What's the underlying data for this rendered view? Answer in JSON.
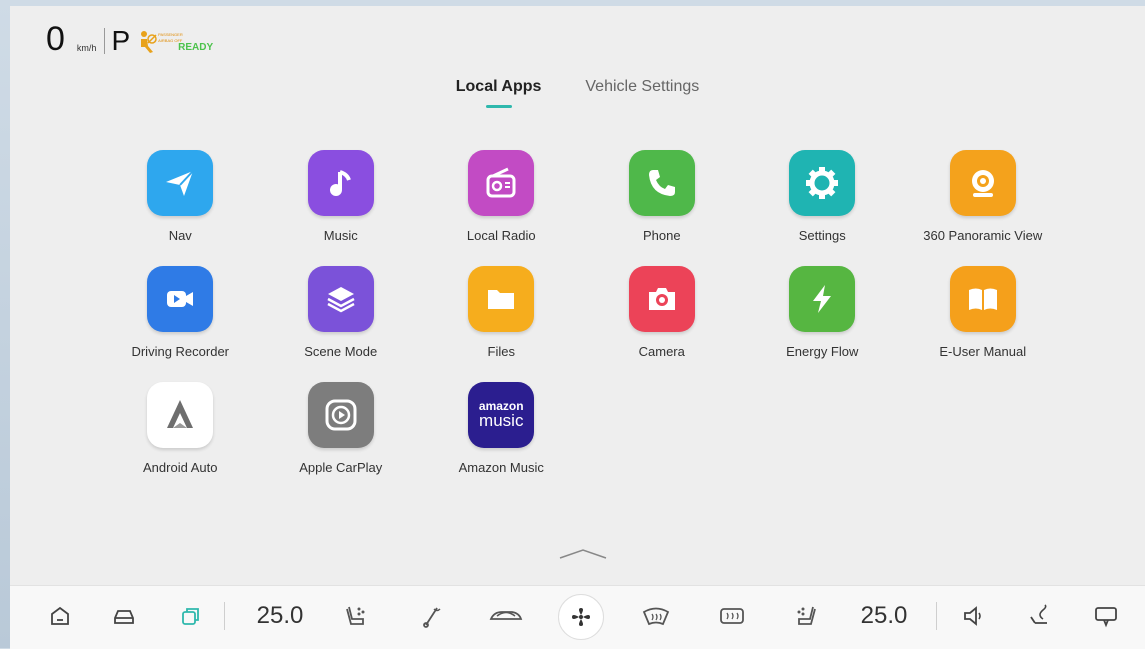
{
  "status": {
    "speed": "0",
    "speed_unit": "km/h",
    "gear": "P",
    "airbag_text": [
      "PASSENGER",
      "AIRBAG OFF"
    ],
    "ready": "READY"
  },
  "tabs": [
    {
      "label": "Local Apps",
      "active": true
    },
    {
      "label": "Vehicle Settings",
      "active": false
    }
  ],
  "apps": [
    {
      "label": "Nav",
      "icon": "navigation-arrow-icon",
      "color": "#2ea7ee"
    },
    {
      "label": "Music",
      "icon": "music-note-icon",
      "color": "#8a4ee0"
    },
    {
      "label": "Local Radio",
      "icon": "radio-icon",
      "color": "#c24bc4"
    },
    {
      "label": "Phone",
      "icon": "phone-icon",
      "color": "#4fb84a"
    },
    {
      "label": "Settings",
      "icon": "gear-icon",
      "color": "#1fb4b2"
    },
    {
      "label": "360 Panoramic View",
      "icon": "camera-360-icon",
      "color": "#f4a21c"
    },
    {
      "label": "Driving Recorder",
      "icon": "video-camera-icon",
      "color": "#2f7be6"
    },
    {
      "label": "Scene Mode",
      "icon": "layers-icon",
      "color": "#7b52d9"
    },
    {
      "label": "Files",
      "icon": "folder-icon",
      "color": "#f6ad1d"
    },
    {
      "label": "Camera",
      "icon": "camera-icon",
      "color": "#ec4358"
    },
    {
      "label": "Energy Flow",
      "icon": "lightning-icon",
      "color": "#56b641"
    },
    {
      "label": "E-User Manual",
      "icon": "book-icon",
      "color": "#f5a01b"
    },
    {
      "label": "Android Auto",
      "icon": "android-auto-icon",
      "color": "#ffffff"
    },
    {
      "label": "Apple CarPlay",
      "icon": "carplay-icon",
      "color": "#7d7d7d"
    },
    {
      "label": "Amazon Music",
      "icon": "amazon-music-icon",
      "color": "#2b1e8f",
      "logo_text": [
        "amazon",
        "music"
      ]
    }
  ],
  "bottom_bar": {
    "temp_left": "25.0",
    "temp_right": "25.0",
    "accent": "#2fb8ad"
  }
}
